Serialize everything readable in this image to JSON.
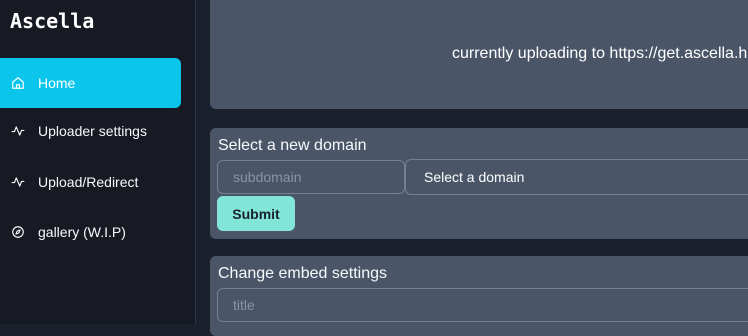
{
  "app": {
    "brand": "Ascella"
  },
  "sidebar": {
    "items": [
      {
        "label": "Home",
        "icon": "home-icon",
        "active": true
      },
      {
        "label": "Uploader settings",
        "icon": "activity-icon",
        "active": false
      },
      {
        "label": "Upload/Redirect",
        "icon": "activity-icon",
        "active": false
      },
      {
        "label": "gallery (W.I.P)",
        "icon": "compass-icon",
        "active": false
      }
    ]
  },
  "status": {
    "text": "currently uploading to https://get.ascella.h"
  },
  "domain_form": {
    "title": "Select a new domain",
    "subdomain_placeholder": "subdomain",
    "domain_select_value": "Select a domain",
    "submit_label": "Submit"
  },
  "embed_form": {
    "title": "Change embed settings",
    "title_placeholder": "title"
  },
  "colors": {
    "accent": "#0bc5ea",
    "submit": "#81e6d9",
    "card": "#4a5568",
    "sidebar": "#171923",
    "background": "#1a202c"
  }
}
